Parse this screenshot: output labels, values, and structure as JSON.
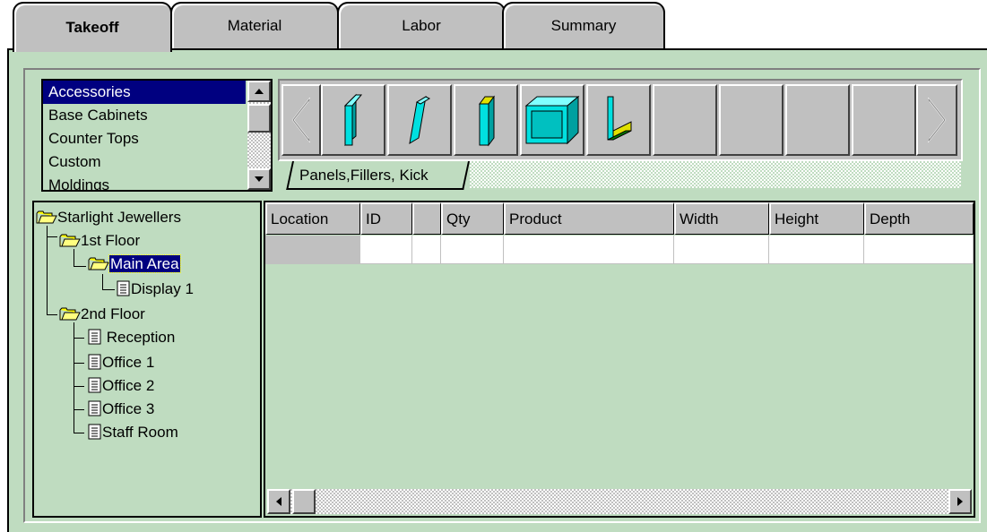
{
  "tabs": [
    {
      "label": "Takeoff",
      "active": true
    },
    {
      "label": "Material",
      "active": false
    },
    {
      "label": "Labor",
      "active": false
    },
    {
      "label": "Summary",
      "active": false
    }
  ],
  "categories": {
    "items": [
      "Accessories",
      "Base Cabinets",
      "Counter Tops",
      "Custom",
      "Moldings"
    ],
    "selected": "Accessories"
  },
  "palette": {
    "tab_label": "Panels,Fillers, Kick",
    "icons": [
      "end-panel-icon",
      "angled-panel-icon",
      "filler-icon",
      "box-panel-icon",
      "kick-icon"
    ]
  },
  "tree": {
    "root": "Starlight Jewellers",
    "floor1": "1st Floor",
    "main_area": "Main Area",
    "display1": "Display 1",
    "floor2": "2nd Floor",
    "reception": "Reception",
    "office1": "Office 1",
    "office2": "Office 2",
    "office3": "Office 3",
    "staff_room": "Staff Room"
  },
  "grid": {
    "columns": [
      "Location",
      "ID",
      "",
      "Qty",
      "Product",
      "Width",
      "Height",
      "Depth"
    ]
  },
  "colors": {
    "panel_bg": "#bfdcc0",
    "selection": "#000080",
    "icon_cyan": "#00e0e0"
  }
}
